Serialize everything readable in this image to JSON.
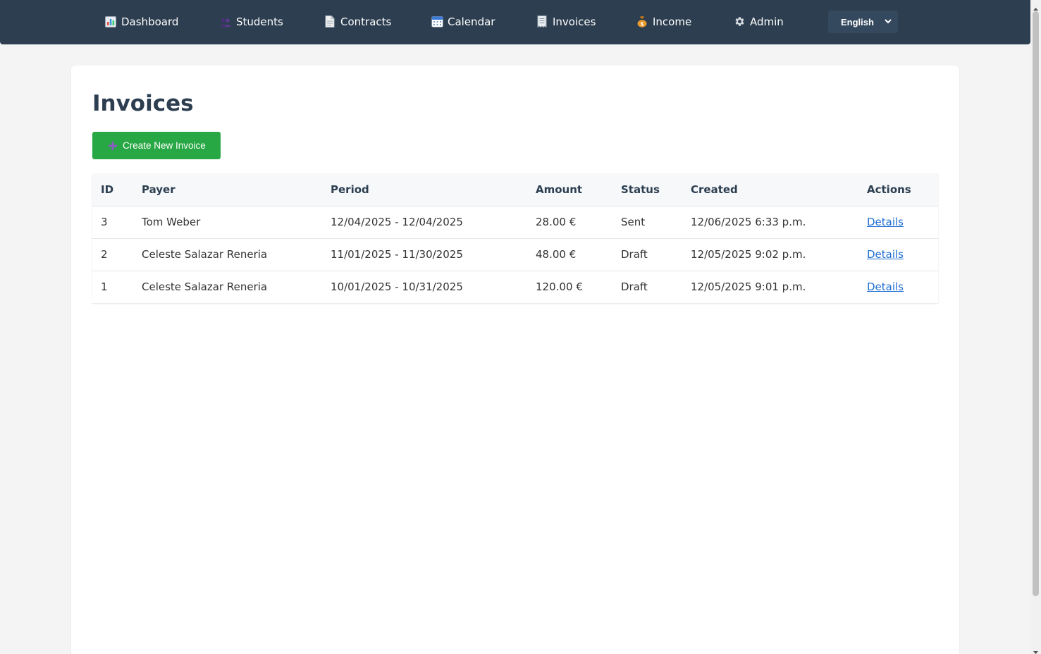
{
  "nav": {
    "items": [
      {
        "label": "Dashboard",
        "icon": "bar-chart-icon"
      },
      {
        "label": "Students",
        "icon": "people-icon"
      },
      {
        "label": "Contracts",
        "icon": "document-icon"
      },
      {
        "label": "Calendar",
        "icon": "calendar-icon"
      },
      {
        "label": "Invoices",
        "icon": "receipt-icon"
      },
      {
        "label": "Income",
        "icon": "money-bag-icon"
      },
      {
        "label": "Admin",
        "icon": "gear-icon"
      }
    ],
    "language": "English"
  },
  "page": {
    "title": "Invoices",
    "create_button": "Create New Invoice"
  },
  "table": {
    "headers": [
      "ID",
      "Payer",
      "Period",
      "Amount",
      "Status",
      "Created",
      "Actions"
    ],
    "rows": [
      {
        "id": "3",
        "payer": "Tom Weber",
        "period": "12/04/2025 - 12/04/2025",
        "amount": "28.00 €",
        "status": "Sent",
        "created": "12/06/2025 6:33 p.m.",
        "action": "Details"
      },
      {
        "id": "2",
        "payer": "Celeste Salazar Reneria",
        "period": "11/01/2025 - 11/30/2025",
        "amount": "48.00 €",
        "status": "Draft",
        "created": "12/05/2025 9:02 p.m.",
        "action": "Details"
      },
      {
        "id": "1",
        "payer": "Celeste Salazar Reneria",
        "period": "10/01/2025 - 10/31/2025",
        "amount": "120.00 €",
        "status": "Draft",
        "created": "12/05/2025 9:01 p.m.",
        "action": "Details"
      }
    ]
  },
  "colors": {
    "nav_bg": "#2c3e50",
    "button_green": "#28a745",
    "link_blue": "#1f6fd1"
  }
}
